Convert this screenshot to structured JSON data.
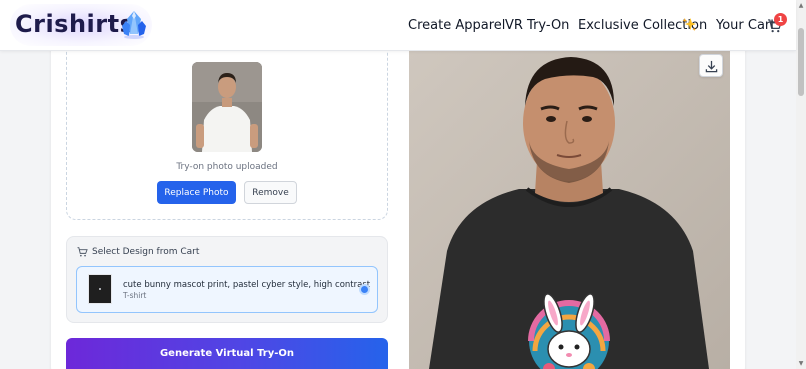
{
  "app": {
    "logo": "Crishirts",
    "logo_icon": "crystal-gem-icon"
  },
  "nav": {
    "create": "Create Apparel",
    "vr": "VR Try-On",
    "exclusive": "Exclusive Collection",
    "exclusive_icon": "sparkle-icon",
    "cart": "Your Cart",
    "cart_icon": "cart-icon",
    "cart_count": "1"
  },
  "upload": {
    "status": "Try-on photo uploaded",
    "replace_label": "Replace Photo",
    "remove_label": "Remove"
  },
  "design": {
    "title": "Select Design from Cart",
    "title_icon": "cart-icon",
    "item_name": "cute bunny mascot print, pastel cyber style, high contrast",
    "item_type": "T-shirt",
    "selected": true
  },
  "generate": {
    "label": "Generate Virtual Try-On"
  },
  "result": {
    "download_icon": "download-icon"
  },
  "colors": {
    "primary": "#2563eb",
    "gradient_start": "#6d28d9",
    "gradient_end": "#2563eb",
    "badge": "#ef4444"
  }
}
